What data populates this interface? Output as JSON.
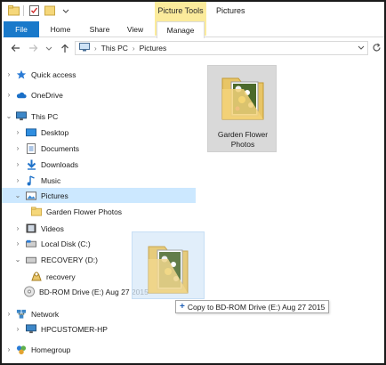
{
  "ribbon": {
    "contextual_label": "Picture Tools",
    "window_title": "Pictures",
    "tabs": {
      "file": "File",
      "home": "Home",
      "share": "Share",
      "view": "View",
      "manage": "Manage"
    }
  },
  "address": {
    "segments": [
      "This PC",
      "Pictures"
    ]
  },
  "navpane": {
    "items": [
      {
        "label": "Quick access",
        "icon": "star-icon"
      },
      {
        "label": "OneDrive",
        "icon": "cloud-icon"
      },
      {
        "label": "This PC",
        "icon": "computer-icon"
      },
      {
        "label": "Desktop",
        "icon": "desktop-icon"
      },
      {
        "label": "Documents",
        "icon": "documents-icon"
      },
      {
        "label": "Downloads",
        "icon": "download-icon"
      },
      {
        "label": "Music",
        "icon": "music-icon"
      },
      {
        "label": "Pictures",
        "icon": "pictures-icon"
      },
      {
        "label": "Garden Flower Photos",
        "icon": "folder-icon"
      },
      {
        "label": "Videos",
        "icon": "videos-icon"
      },
      {
        "label": "Local Disk (C:)",
        "icon": "drive-icon"
      },
      {
        "label": "RECOVERY (D:)",
        "icon": "drive-icon"
      },
      {
        "label": "recovery",
        "icon": "recovery-icon"
      },
      {
        "label": "BD-ROM Drive (E:) Aug 27 2015",
        "icon": "disc-icon"
      },
      {
        "label": "Network",
        "icon": "network-icon"
      },
      {
        "label": "HPCUSTOMER-HP",
        "icon": "computer-icon"
      },
      {
        "label": "Homegroup",
        "icon": "homegroup-icon"
      }
    ]
  },
  "content": {
    "folder_caption": "Garden Flower Photos"
  },
  "drag": {
    "tooltip": "Copy to BD-ROM Drive (E:) Aug 27 2015"
  },
  "colors": {
    "accent": "#1979ca",
    "selection": "#cce8ff",
    "contextual": "#fbeb9c",
    "folder": "#f5d77a"
  }
}
